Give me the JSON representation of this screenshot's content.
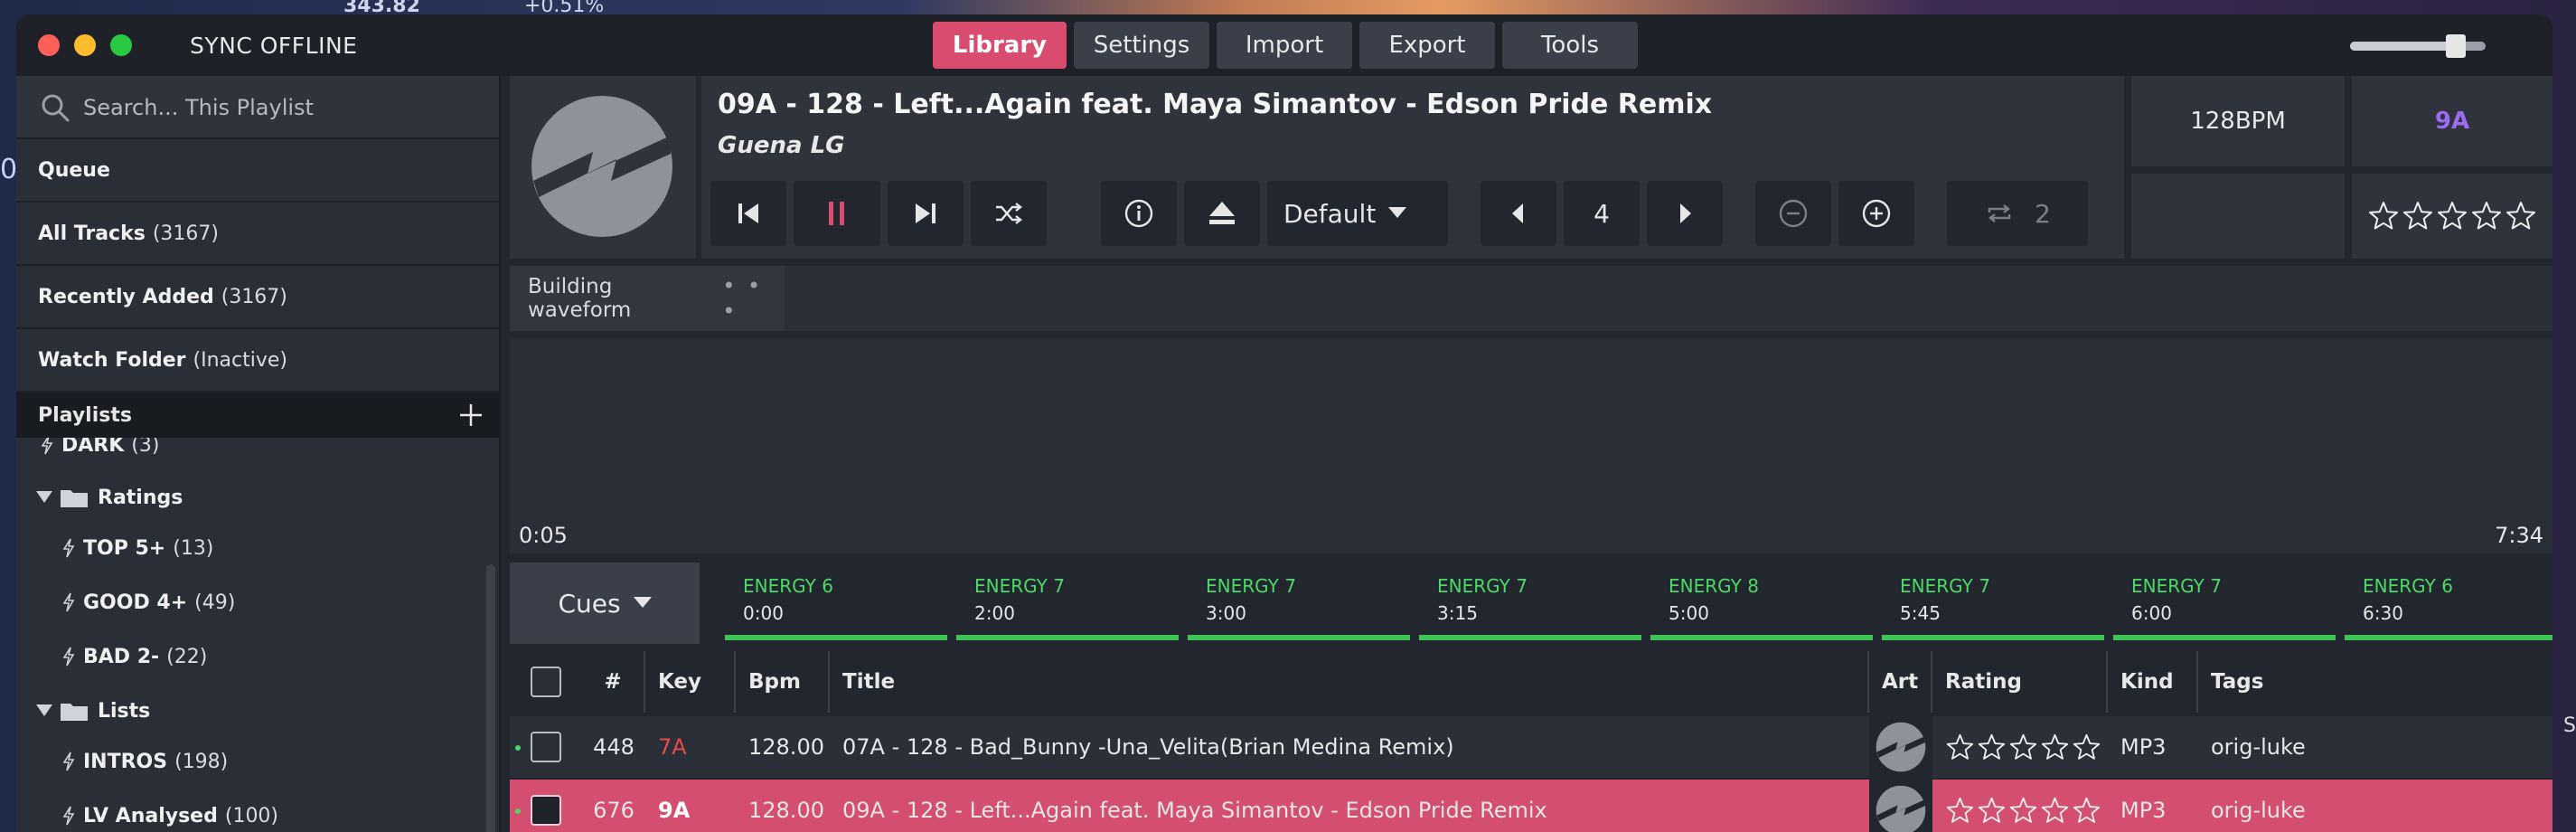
{
  "backdrop": {
    "ticker_left": "343.82",
    "ticker_right": "+0.51%",
    "edge_left": "0",
    "edge_right": "S"
  },
  "window": {
    "sync_status": "SYNC OFFLINE",
    "volume_fraction": 0.78
  },
  "tabs": [
    {
      "label": "Library",
      "active": true
    },
    {
      "label": "Settings",
      "active": false
    },
    {
      "label": "Import",
      "active": false
    },
    {
      "label": "Export",
      "active": false
    },
    {
      "label": "Tools",
      "active": false
    }
  ],
  "sidebar": {
    "search_placeholder": "Search... This Playlist",
    "items": [
      {
        "label": "Queue",
        "count": ""
      },
      {
        "label": "All Tracks",
        "count": "(3167)"
      },
      {
        "label": "Recently Added",
        "count": "(3167)"
      },
      {
        "label": "Watch Folder",
        "count": "(Inactive)"
      }
    ],
    "playlists_header": "Playlists",
    "tree": {
      "dark": {
        "label": "DARK",
        "count": "(3)"
      },
      "ratings_folder": "Ratings",
      "top5": {
        "label": "TOP 5+",
        "count": "(13)"
      },
      "good4": {
        "label": "GOOD 4+",
        "count": "(49)"
      },
      "bad2": {
        "label": "BAD 2-",
        "count": "(22)"
      },
      "lists_folder": "Lists",
      "intros": {
        "label": "INTROS",
        "count": "(198)"
      },
      "lv": {
        "label": "LV Analysed",
        "count": "(100)"
      }
    }
  },
  "deck": {
    "title": "09A - 128 - Left...Again feat. Maya Simantov - Edson Pride Remix",
    "artist": "Guena LG",
    "preset": "Default",
    "nudge_value": "4",
    "loop_value": "2",
    "bpm": "128BPM",
    "key": "9A",
    "rating": 0
  },
  "waveform": {
    "status": "Building waveform",
    "dots": "• • •",
    "elapsed": "0:05",
    "total": "7:34"
  },
  "cues": {
    "button_label": "Cues",
    "items": [
      {
        "label": "ENERGY 6",
        "time": "0:00"
      },
      {
        "label": "ENERGY 7",
        "time": "2:00"
      },
      {
        "label": "ENERGY 7",
        "time": "3:00"
      },
      {
        "label": "ENERGY 7",
        "time": "3:15"
      },
      {
        "label": "ENERGY 8",
        "time": "5:00"
      },
      {
        "label": "ENERGY 7",
        "time": "5:45"
      },
      {
        "label": "ENERGY 7",
        "time": "6:00"
      },
      {
        "label": "ENERGY 6",
        "time": "6:30"
      }
    ]
  },
  "table": {
    "columns": {
      "num": "#",
      "key": "Key",
      "bpm": "Bpm",
      "title": "Title",
      "art": "Art",
      "rating": "Rating",
      "kind": "Kind",
      "tags": "Tags"
    },
    "rows": [
      {
        "num": "448",
        "key": "7A",
        "bpm": "128.00",
        "title": "07A - 128 - Bad_Bunny -Una_Velita(Brian Medina Remix)",
        "kind": "MP3",
        "tags": "orig-luke",
        "selected": false
      },
      {
        "num": "676",
        "key": "9A",
        "bpm": "128.00",
        "title": "09A - 128 - Left...Again feat. Maya Simantov - Edson Pride Remix",
        "kind": "MP3",
        "tags": "orig-luke",
        "selected": true
      }
    ]
  },
  "colors": {
    "accent": "#d94c6f",
    "key_purple": "#9b6cf2",
    "cue_green": "#4cd964",
    "key_red": "#e84a4a"
  }
}
